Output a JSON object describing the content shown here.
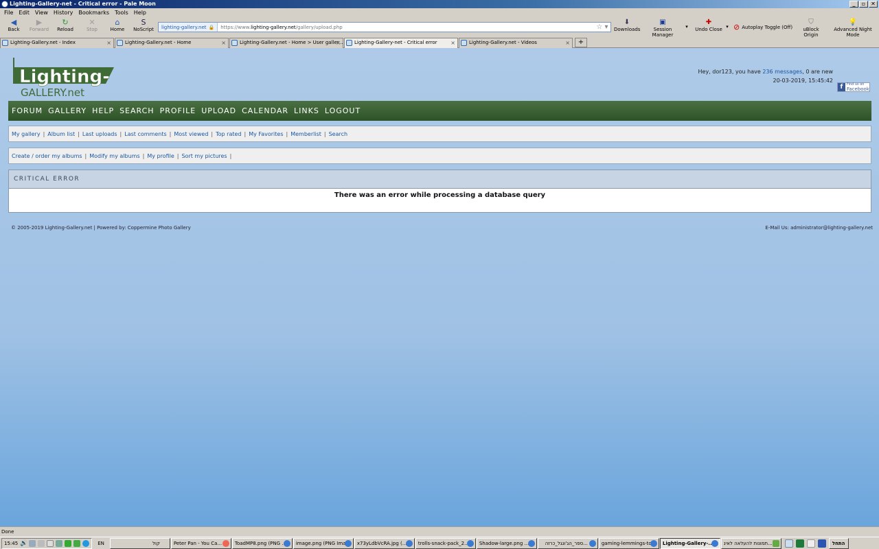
{
  "window": {
    "title": "Lighting-Gallery-net - Critical error - Pale Moon",
    "buttons": [
      "_",
      "▫",
      "✕"
    ]
  },
  "menubar": [
    "File",
    "Edit",
    "View",
    "History",
    "Bookmarks",
    "Tools",
    "Help"
  ],
  "toolbar": {
    "back": "Back",
    "forward": "Forward",
    "reload": "Reload",
    "stop": "Stop",
    "home": "Home",
    "noscript": "NoScript",
    "identity": "lighting-gallery.net",
    "url_prefix": "https://www.",
    "url_domain": "lighting-gallery.net",
    "url_path": "/gallery/upload.php",
    "downloads": "Downloads",
    "session_manager": "Session Manager",
    "undo_close": "Undo Close",
    "autoplay": "Autoplay Toggle (Off)",
    "ublock": "uBlock Origin",
    "night_mode": "Advanced Night Mode"
  },
  "tabs": [
    {
      "label": "Lighting-Gallery.net - Index"
    },
    {
      "label": "Lighting-Gallery.net - Home"
    },
    {
      "label": "Lighting-Gallery.net - Home > User galler..."
    },
    {
      "label": "Lighting-Gallery-net - Critical error"
    },
    {
      "label": "Lighting-Gallery.net - Videos"
    }
  ],
  "site": {
    "logo_main": "Lighting-",
    "logo_sub": "GALLERY.net",
    "greeting_prefix": "Hey, dor123, you have ",
    "messages_link": "236 messages",
    "greeting_suffix": ", 0 are new",
    "datetime": "20-03-2019, 15:45:42",
    "fb_line1": "Find us on",
    "fb_line2": "Facebook",
    "mainnav": [
      "FORUM",
      "GALLERY",
      "HELP",
      "SEARCH",
      "PROFILE",
      "UPLOAD",
      "CALENDAR",
      "LINKS",
      "LOGOUT"
    ],
    "subnav1": [
      "My gallery",
      "Album list",
      "Last uploads",
      "Last comments",
      "Most viewed",
      "Top rated",
      "My Favorites",
      "Memberlist",
      "Search"
    ],
    "subnav2": [
      "Create / order my albums",
      "Modify my albums",
      "My profile",
      "Sort my pictures"
    ],
    "error_title": "CRITICAL ERROR",
    "error_message": "There was an error while processing a database query",
    "footer_left": "© 2005-2019 Lighting-Gallery.net | Powered by: Coppermine Photo Gallery",
    "footer_right": "E-Mail Us: administrator@lighting-gallery.net"
  },
  "status": "Done",
  "taskbar": {
    "clock": "15:45",
    "lang": "EN",
    "buttons": [
      {
        "label": "קול"
      },
      {
        "label": "Peter Pan - You Ca..."
      },
      {
        "label": "ToadMP8.png (PNG ..."
      },
      {
        "label": "image.png (PNG Ima..."
      },
      {
        "label": "x73yLdbVcRA.jpg (..."
      },
      {
        "label": "trolls-snack-pack_2..."
      },
      {
        "label": "Shadow-large.png ..."
      },
      {
        "label": "ספר_הג'ונגל_כרזה..."
      },
      {
        "label": "gaming-lemmings-to..."
      },
      {
        "label": "Lighting-Gallery-..."
      },
      {
        "label": "תמונות להעלאה לאינ..."
      }
    ],
    "start": "התחל"
  }
}
